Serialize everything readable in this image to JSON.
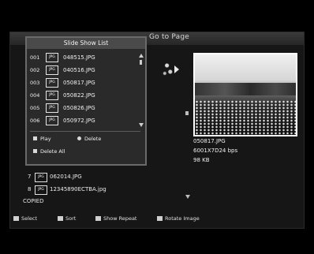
{
  "header": {
    "title": "Go to Page"
  },
  "file_list": [
    {
      "num": "7",
      "icon": "JPG",
      "name": "062014.JPG"
    },
    {
      "num": "8",
      "icon": "JPG",
      "name": "12345890ECTBA.jpg"
    }
  ],
  "status": {
    "copied": "COPIED"
  },
  "preview": {
    "filename": "050817.JPG",
    "resolution": "6001X7D24 bps",
    "size": "98 KB"
  },
  "help": [
    {
      "icon": "red-button-icon",
      "label": "Select"
    },
    {
      "icon": "green-button-icon",
      "label": "Sort"
    },
    {
      "icon": "yellow-button-icon",
      "label": "Show Repeat"
    },
    {
      "icon": "blue-button-icon",
      "label": "Rotate Image"
    }
  ],
  "slide_show_list": {
    "title": "Slide Show List",
    "items": [
      {
        "num": "001",
        "icon": "JPG",
        "name": "048515.JPG"
      },
      {
        "num": "002",
        "icon": "JPG",
        "name": "040516.JPG"
      },
      {
        "num": "003",
        "icon": "JPG",
        "name": "050817.JPG"
      },
      {
        "num": "004",
        "icon": "JPG",
        "name": "050822.JPG"
      },
      {
        "num": "005",
        "icon": "JPG",
        "name": "050826.JPG"
      },
      {
        "num": "006",
        "icon": "JPG",
        "name": "050972.JPG"
      }
    ],
    "actions": [
      {
        "key": "red-button-icon",
        "label": "Play"
      },
      {
        "key": "green-button-icon",
        "label": "Delete"
      },
      {
        "key": "yellow-button-icon",
        "label": "Delete All"
      }
    ]
  },
  "colors": {
    "screen_bg": "#161616",
    "popup_bg": "#2a2a2a",
    "title_bar": "#3a3a3a"
  }
}
